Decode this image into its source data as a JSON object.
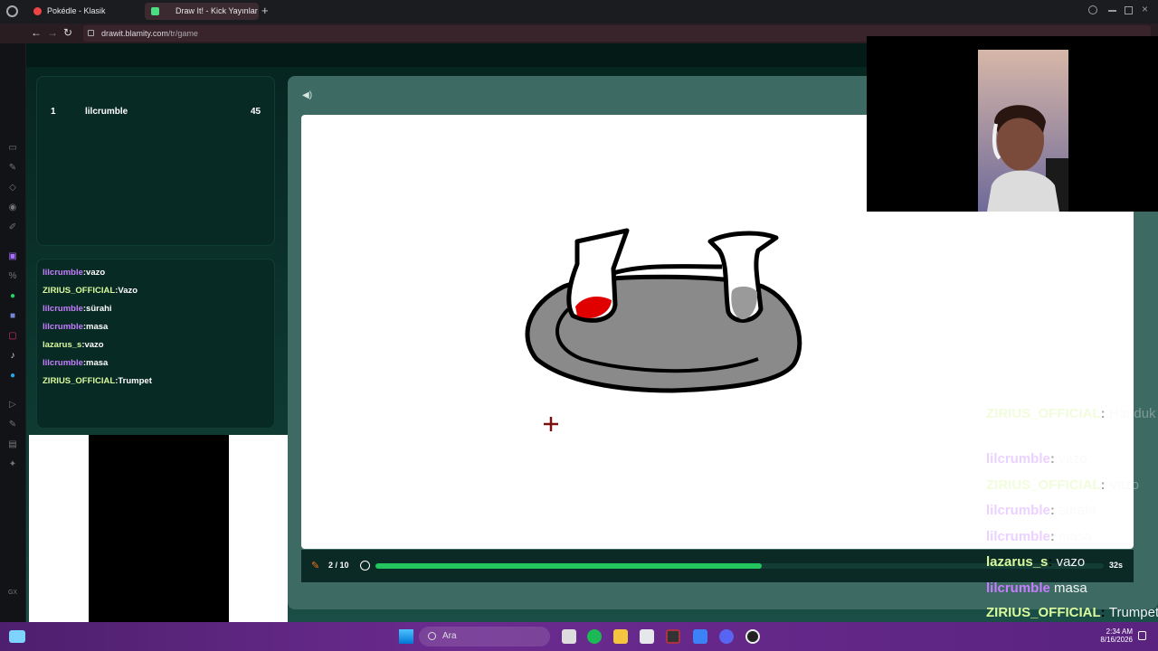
{
  "browser": {
    "tabs": [
      {
        "label": "Pokédle - Klasik",
        "active": false
      },
      {
        "label": "Draw It! - Kick Yayınlar",
        "active": true
      }
    ],
    "url_host": "drawit.blamity.com",
    "url_path": "/tr/game"
  },
  "leaderboard": {
    "rows": [
      {
        "rank": "1",
        "name": "lilcrumble",
        "score": "45"
      }
    ]
  },
  "game_chat": [
    {
      "user": "lilcrumble",
      "sep": ":",
      "msg": "vazo",
      "color": "#c77dff"
    },
    {
      "user": "ZIRIUS_OFFICIAL",
      "sep": ":",
      "msg": "Vazo",
      "color": "#d9f99d"
    },
    {
      "user": "lilcrumble",
      "sep": ":",
      "msg": "sürahi",
      "color": "#c77dff"
    },
    {
      "user": "lilcrumble",
      "sep": ":",
      "msg": "masa",
      "color": "#c77dff"
    },
    {
      "user": "lazarus_s",
      "sep": ":",
      "msg": "vazo",
      "color": "#d9f99d"
    },
    {
      "user": "lilcrumble",
      "sep": ":",
      "msg": "masa",
      "color": "#c77dff"
    },
    {
      "user": "ZIRIUS_OFFICIAL",
      "sep": ":",
      "msg": "Trumpet",
      "color": "#d9f99d"
    }
  ],
  "round": {
    "counter": "2 / 10",
    "timer": "32s",
    "progress": 0.53
  },
  "stream_chat": [
    {
      "user": "ZIRIUS_OFFICIAL",
      "sep": ":",
      "msg": "Handuk",
      "color": "#d9f99d",
      "faded": true
    },
    {
      "user": "lilcrumble",
      "sep": ":",
      "msg": "vazo",
      "color": "#c77dff",
      "faded": true
    },
    {
      "user": "ZIRIUS_OFFICIAL",
      "sep": ":",
      "msg": "Vazo",
      "color": "#d9f99d",
      "faded": true
    },
    {
      "user": "lilcrumble",
      "sep": ":",
      "msg": "sürahi",
      "color": "#c77dff",
      "faded": true
    },
    {
      "user": "lilcrumble",
      "sep": ":",
      "msg": "masa",
      "color": "#c77dff",
      "faded": true
    },
    {
      "user": "lazarus_s",
      "sep": ":",
      "msg": "vazo",
      "color": "#d9f99d",
      "faded": false
    },
    {
      "user": "lilcrumble",
      "sep": "",
      "msg": "masa",
      "color": "#c77dff",
      "faded": false
    },
    {
      "user": "ZIRIUS_OFFICIAL",
      "sep": ":",
      "msg": "Trumpet",
      "color": "#d9f99d",
      "faded": false
    }
  ],
  "taskbar": {
    "search_placeholder": "Ara",
    "time": "2:34 AM",
    "date": "8/16/2026"
  },
  "colors": {
    "accent_green": "#23c55e",
    "user_purple": "#c77dff",
    "user_lime": "#d9f99d"
  }
}
